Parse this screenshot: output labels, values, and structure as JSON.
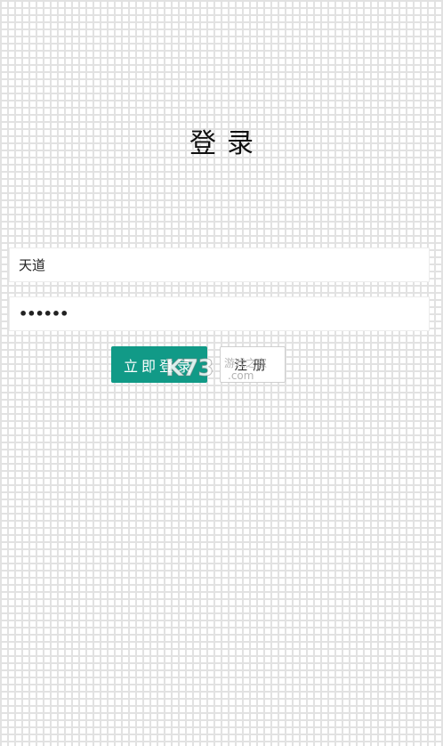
{
  "page": {
    "title": "登录"
  },
  "form": {
    "username_value": "天道",
    "password_mask": "••••••"
  },
  "buttons": {
    "login_label": "立即登录",
    "reset_label": "注册"
  },
  "watermark": {
    "logo": "K73",
    "text": "游戏之家",
    "domain": ".com"
  },
  "colors": {
    "login_button": "#119a87",
    "background_grid": "#e2e2e2"
  }
}
